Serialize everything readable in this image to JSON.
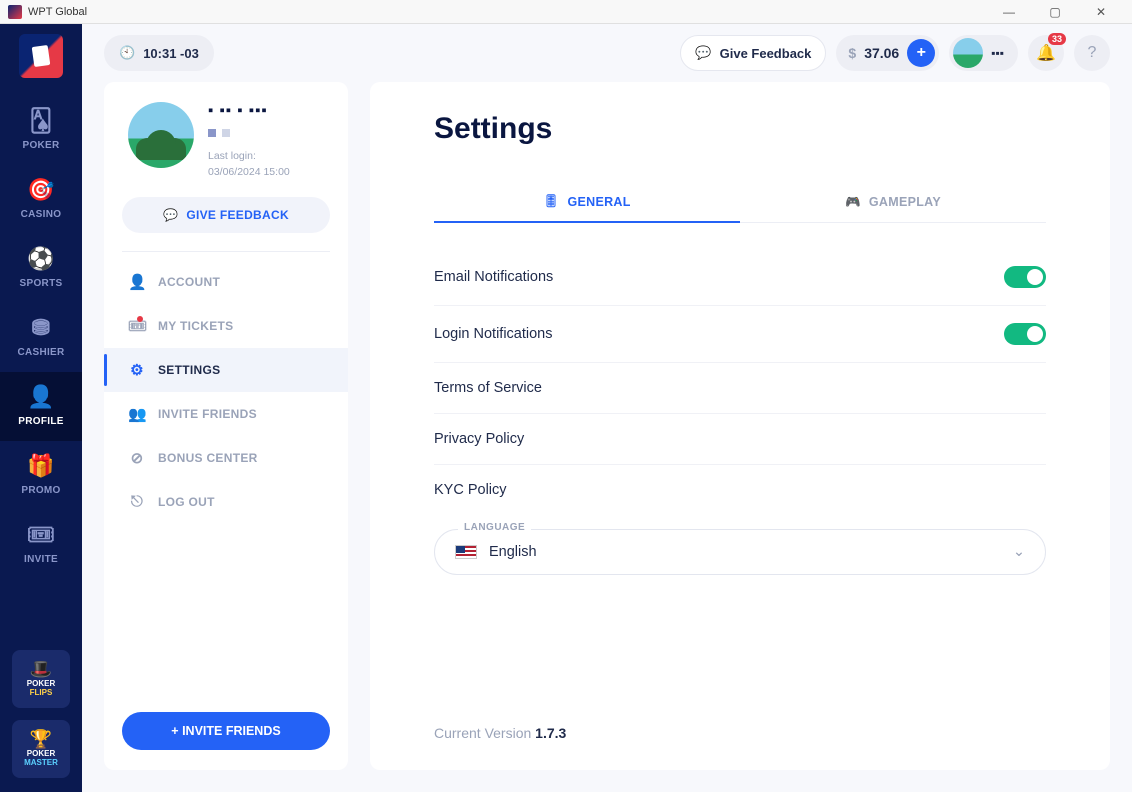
{
  "window": {
    "title": "WPT Global"
  },
  "topbar": {
    "time": "10:31 -03",
    "feedback": "Give Feedback",
    "balance": "37.06",
    "username": "▪▪▪",
    "notif_count": "33"
  },
  "leftnav": {
    "items": [
      {
        "label": "POKER",
        "icon": "🂡"
      },
      {
        "label": "CASINO",
        "icon": "🎯"
      },
      {
        "label": "SPORTS",
        "icon": "⚽"
      },
      {
        "label": "CASHIER",
        "icon": "💳"
      },
      {
        "label": "PROFILE",
        "icon": "👤"
      },
      {
        "label": "PROMO",
        "icon": "🎁"
      },
      {
        "label": "INVITE",
        "icon": "🎟"
      }
    ],
    "promo1_line1": "POKER",
    "promo1_line2": "FLIPS",
    "promo2_line1": "POKER",
    "promo2_line2": "MASTER"
  },
  "profile": {
    "username": "▪ ▪▪ ▪ ▪▪▪",
    "lastlogin_label": "Last login:",
    "lastlogin_value": "03/06/2024 15:00",
    "give_feedback": "GIVE FEEDBACK",
    "menu": {
      "account": "ACCOUNT",
      "mytickets": "MY TICKETS",
      "settings": "SETTINGS",
      "invite": "INVITE FRIENDS",
      "bonus": "BONUS CENTER",
      "logout": "LOG OUT"
    },
    "invite_btn": "+ INVITE FRIENDS"
  },
  "settings": {
    "title": "Settings",
    "tab_general": "GENERAL",
    "tab_gameplay": "GAMEPLAY",
    "email_notif": "Email Notifications",
    "login_notif": "Login Notifications",
    "tos": "Terms of Service",
    "privacy": "Privacy Policy",
    "kyc": "KYC Policy",
    "language_label": "LANGUAGE",
    "language_value": "English",
    "version_label": "Current Version ",
    "version_value": "1.7.3"
  }
}
